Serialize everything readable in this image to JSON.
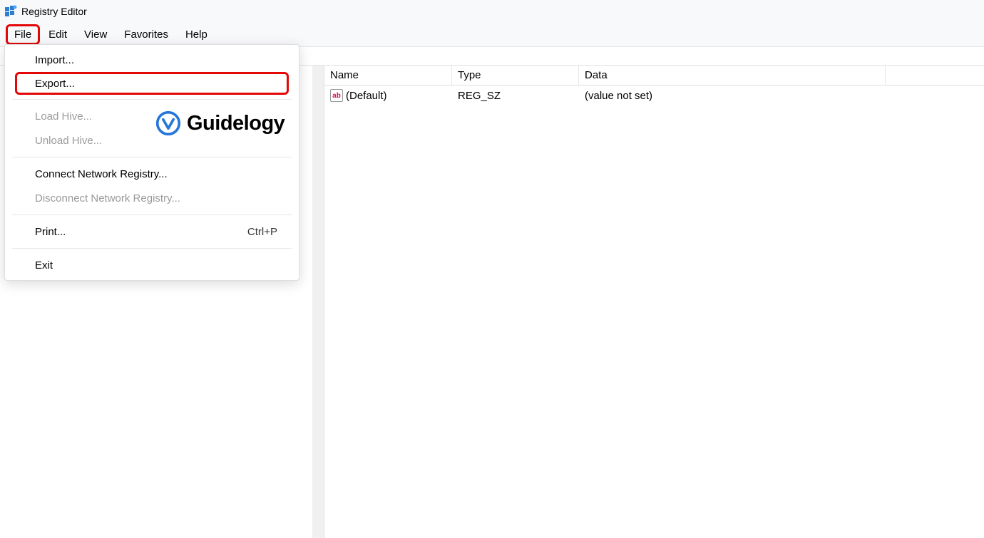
{
  "window": {
    "title": "Registry Editor"
  },
  "menubar": {
    "file": "File",
    "edit": "Edit",
    "view": "View",
    "favorites": "Favorites",
    "help": "Help"
  },
  "file_menu": {
    "import": "Import...",
    "export": "Export...",
    "load_hive": "Load Hive...",
    "unload_hive": "Unload Hive...",
    "connect": "Connect Network Registry...",
    "disconnect": "Disconnect Network Registry...",
    "print": "Print...",
    "print_shortcut": "Ctrl+P",
    "exit": "Exit"
  },
  "list": {
    "headers": {
      "name": "Name",
      "type": "Type",
      "data": "Data"
    },
    "rows": [
      {
        "name": "(Default)",
        "type": "REG_SZ",
        "data": "(value not set)",
        "icon": "ab"
      }
    ]
  },
  "watermark": {
    "text": "Guidelogy"
  }
}
